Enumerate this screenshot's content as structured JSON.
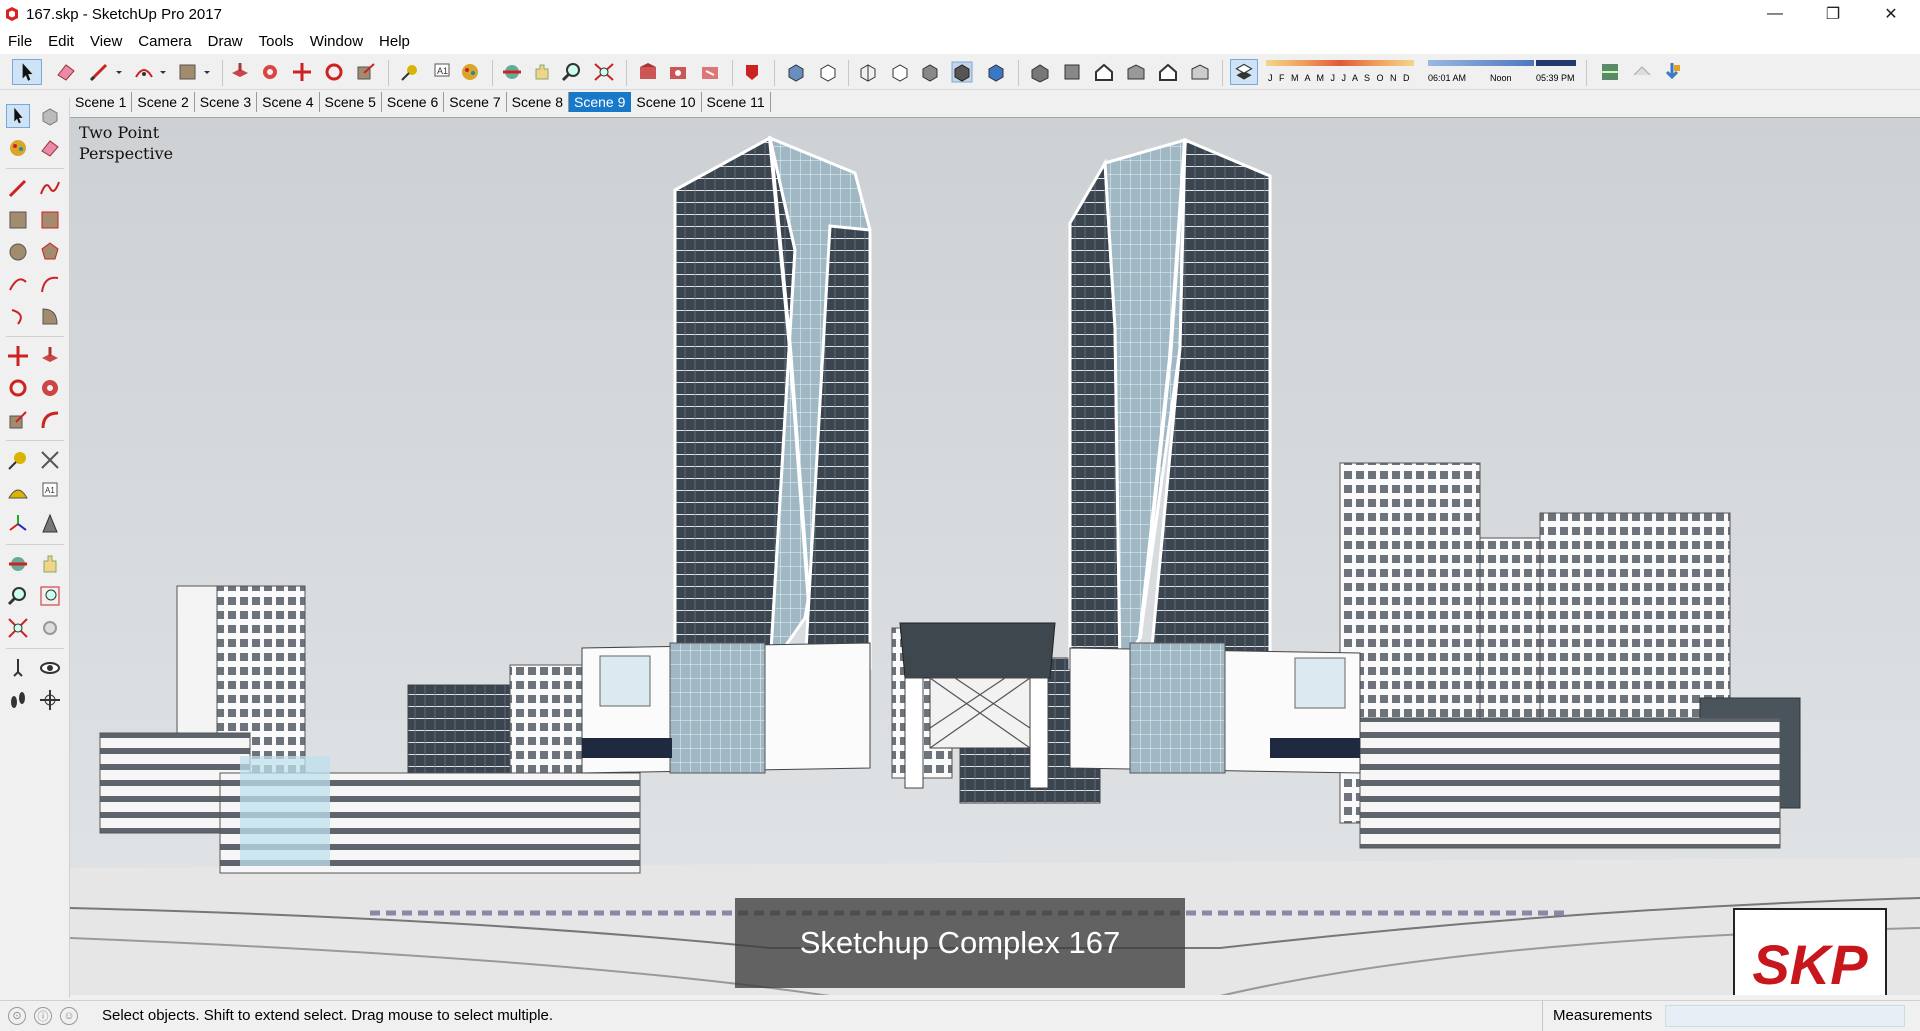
{
  "window": {
    "title": "167.skp - SketchUp Pro 2017",
    "minimize_glyph": "—",
    "restore_glyph": "❐",
    "close_glyph": "✕"
  },
  "menu": [
    "File",
    "Edit",
    "View",
    "Camera",
    "Draw",
    "Tools",
    "Window",
    "Help"
  ],
  "shadow_settings": {
    "months": "J F M A M J J A S O N D",
    "time_start": "06:01 AM",
    "time_mid": "Noon",
    "time_end": "05:39 PM"
  },
  "scenes": {
    "tabs": [
      "Scene 1",
      "Scene 2",
      "Scene 3",
      "Scene 4",
      "Scene 5",
      "Scene 6",
      "Scene 7",
      "Scene 8",
      "Scene 9",
      "Scene 10",
      "Scene 11"
    ],
    "active": "Scene 9"
  },
  "viewport": {
    "camera_label_line1": "Two Point",
    "camera_label_line2": "Perspective",
    "caption": "Sketchup Complex 167",
    "logo_text": "SKP"
  },
  "status": {
    "hint": "Select objects. Shift to extend select. Drag mouse to select multiple.",
    "measurements_label": "Measurements",
    "measurements_value": ""
  },
  "colors": {
    "active_tab": "#1979c9",
    "sky": "#d9dde0",
    "glass": "#3a4a58",
    "logo_red": "#c8161d"
  }
}
